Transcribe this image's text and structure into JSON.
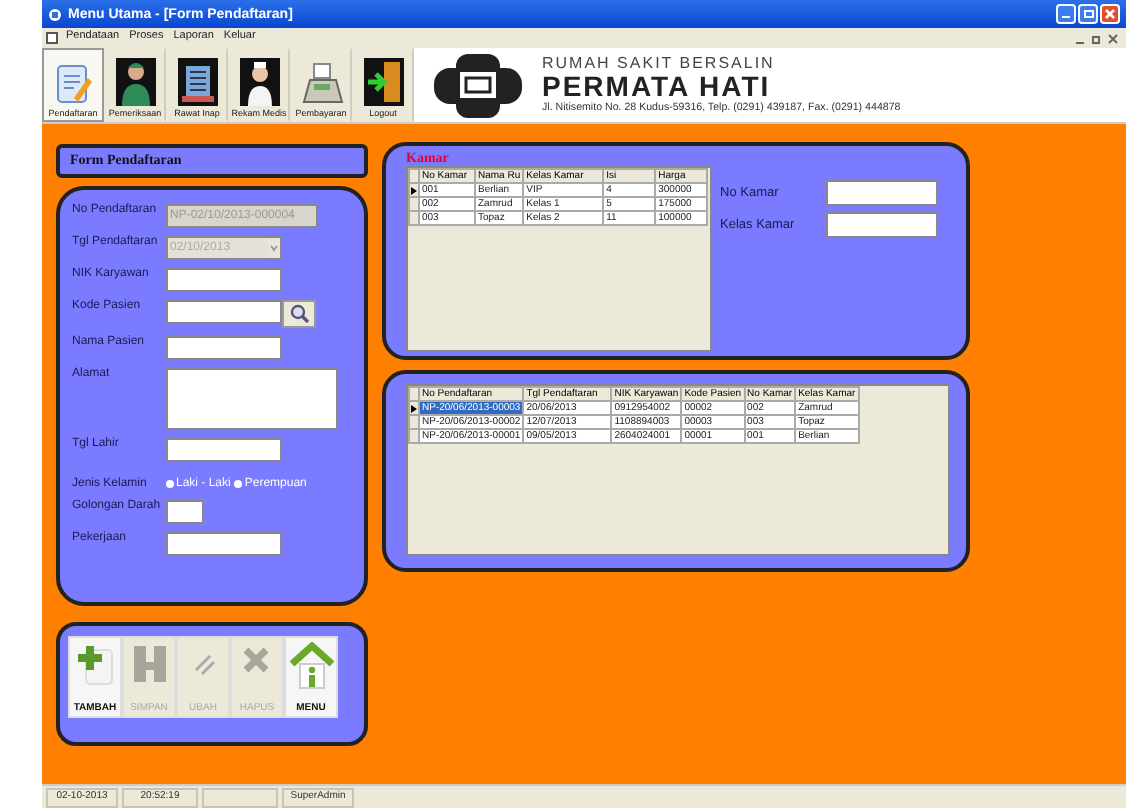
{
  "window": {
    "title": "Menu Utama - [Form Pendaftaran]"
  },
  "menu": [
    "Pendataan",
    "Proses",
    "Laporan",
    "Keluar"
  ],
  "toolbar": [
    {
      "label": "Pendaftaran",
      "kind": "form",
      "selected": true
    },
    {
      "label": "Pemeriksaan",
      "kind": "doctor",
      "selected": false
    },
    {
      "label": "Rawat Inap",
      "kind": "building",
      "selected": false
    },
    {
      "label": "Rekam Medis",
      "kind": "nurse",
      "selected": false
    },
    {
      "label": "Pembayaran",
      "kind": "register",
      "selected": false
    },
    {
      "label": "Logout",
      "kind": "door",
      "selected": false
    }
  ],
  "header": {
    "subtitle": "RUMAH SAKIT BERSALIN",
    "name": "PERMATA HATI",
    "address": "Jl. Nitisemito No. 28 Kudus-59316, Telp. (0291) 439187, Fax. (0291) 444878"
  },
  "form": {
    "title": "Form Pendaftaran",
    "fields": [
      {
        "label": "No Pendaftaran",
        "kind": "wide",
        "value": "NP-02/10/2013-000004",
        "disabled": true
      },
      {
        "label": "Tgl Pendaftaran",
        "kind": "date",
        "value": "02/10/2013",
        "disabled": true
      },
      {
        "label": "NIK Karyawan",
        "kind": "text",
        "disabled": false
      },
      {
        "label": "Kode Pasien",
        "kind": "search",
        "disabled": false
      },
      {
        "label": "Nama Pasien",
        "kind": "text",
        "disabled": false
      },
      {
        "label": "Alamat",
        "kind": "textarea",
        "disabled": false
      },
      {
        "label": "Tgl Lahir",
        "kind": "text",
        "disabled": false
      },
      {
        "label": "Jenis Kelamin",
        "kind": "radio",
        "options": [
          {
            "label": "Laki - Laki",
            "selected": false
          },
          {
            "label": "Perempuan",
            "selected": false
          }
        ]
      },
      {
        "label": "Golongan Darah",
        "kind": "short",
        "disabled": false
      },
      {
        "label": "Pekerjaan",
        "kind": "text",
        "disabled": false
      }
    ]
  },
  "kamar": {
    "title": "Kamar",
    "columns": [
      "No Kamar",
      "Nama Ru",
      "Kelas Kamar",
      "Isi",
      "Harga"
    ],
    "rows": [
      {
        "cells": [
          "001",
          "Berlian",
          "VIP",
          "4",
          "300000"
        ],
        "selected": true
      },
      {
        "cells": [
          "002",
          "Zamrud",
          "Kelas 1",
          "5",
          "175000"
        ],
        "selected": false
      },
      {
        "cells": [
          "003",
          "Topaz",
          "Kelas 2",
          "11",
          "100000"
        ],
        "selected": false
      }
    ],
    "fields": [
      {
        "label": "No Kamar"
      },
      {
        "label": "Kelas Kamar"
      }
    ]
  },
  "pendaftaran": {
    "columns": [
      "No Pendaftaran",
      "Tgl Pendaftaran",
      "NIK Karyawan",
      "Kode Pasien",
      "No Kamar",
      "Kelas Kamar"
    ],
    "rows": [
      {
        "cells": [
          "NP-20/06/2013-00003",
          "20/06/2013",
          "0912954002",
          "00002",
          "002",
          "Zamrud"
        ],
        "selected": true
      },
      {
        "cells": [
          "NP-20/06/2013-00002",
          "12/07/2013",
          "1108894003",
          "00003",
          "003",
          "Topaz"
        ],
        "selected": false
      },
      {
        "cells": [
          "NP-20/06/2013-00001",
          "09/05/2013",
          "2604024001",
          "00001",
          "001",
          "Berlian"
        ],
        "selected": false
      }
    ]
  },
  "buttons": [
    {
      "label": "TAMBAH",
      "kind": "add",
      "disabled": false
    },
    {
      "label": "SIMPAN",
      "kind": "save",
      "disabled": true
    },
    {
      "label": "UBAH",
      "kind": "edit",
      "disabled": true
    },
    {
      "label": "HAPUS",
      "kind": "delete",
      "disabled": true
    },
    {
      "label": "MENU",
      "kind": "home",
      "disabled": false
    }
  ],
  "status_bar": [
    {
      "kind": "text",
      "text": "02-10-2013"
    },
    {
      "kind": "text",
      "text": "20:52:19"
    },
    {
      "kind": "empty"
    },
    {
      "kind": "text",
      "text": "SuperAdmin"
    }
  ]
}
